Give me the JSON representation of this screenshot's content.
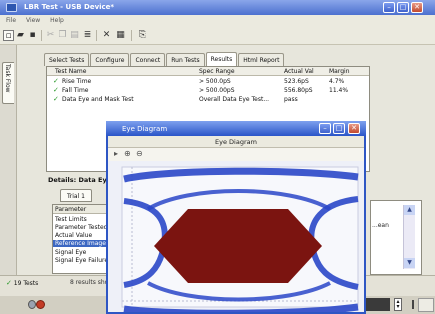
{
  "main_window": {
    "title": "LBR Test - USB Device*"
  },
  "menu": [
    "File",
    "View",
    "Help"
  ],
  "toolbar_icons": [
    "new-file-icon",
    "open-folder-icon",
    "save-icon",
    "cut-icon",
    "copy-icon",
    "paste-icon",
    "delete-icon",
    "properties-icon",
    "export-icon"
  ],
  "task_flow": {
    "label": "Task Flow"
  },
  "tabs": [
    "Select Tests",
    "Configure",
    "Connect",
    "Run Tests",
    "Results",
    "Html Report"
  ],
  "active_tab": "Results",
  "results": {
    "columns": [
      "Test Name",
      "Spec Range",
      "Actual Val",
      "Margin"
    ],
    "rows": [
      {
        "name": "Rise Time",
        "spec": "> 500.0pS",
        "actual": "523.6pS",
        "margin": "4.7%"
      },
      {
        "name": "Fall Time",
        "spec": "> 500.00pS",
        "actual": "556.80pS",
        "margin": "11.4%"
      },
      {
        "name": "Data Eye and Mask Test",
        "spec": "Overall Data Eye Test...",
        "actual": "pass",
        "margin": ""
      }
    ]
  },
  "details": {
    "title": "Details: Data Ey",
    "trial_tab": "Trial 1",
    "param_header": "Parameter",
    "param_rows": [
      "Test Limits",
      "Parameter Tested",
      "Actual Value",
      "Reference Image",
      "Signal Eye",
      "Signal Eye Failures"
    ],
    "selected_row": 3
  },
  "right_panel_text": "...ean",
  "status": {
    "tests": "19 Tests",
    "results": "8 results sho..."
  },
  "eye_window": {
    "title": "Eye Diagram",
    "header": "Eye Diagram",
    "tools": [
      "pointer-icon",
      "zoom-in-icon",
      "zoom-out-icon"
    ]
  },
  "colors": {
    "mask": "#7b1410",
    "trace": "#2a47c8",
    "titlebar": "#2a55c8"
  }
}
